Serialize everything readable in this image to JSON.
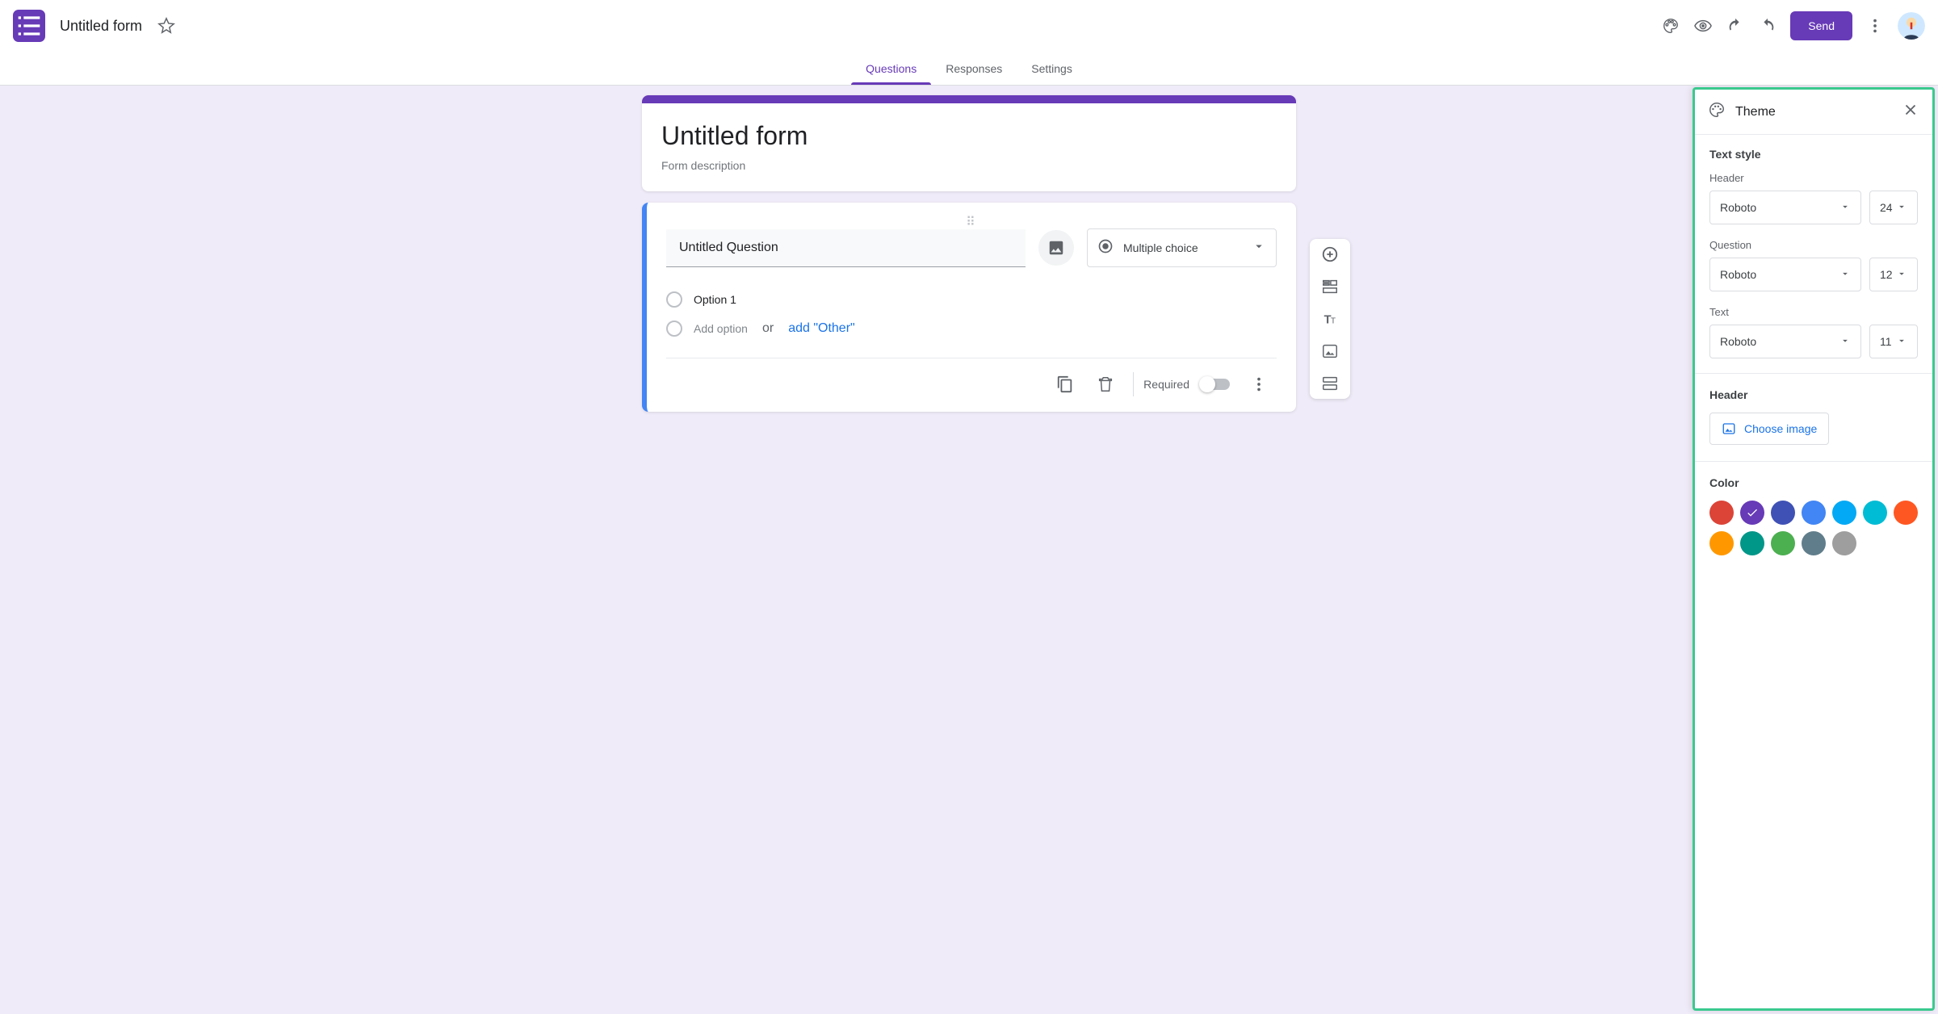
{
  "header": {
    "doc_title": "Untitled form",
    "send_label": "Send"
  },
  "tabs": {
    "questions": "Questions",
    "responses": "Responses",
    "settings": "Settings"
  },
  "form": {
    "title": "Untitled form",
    "description_placeholder": "Form description",
    "question_text": "Untitled Question",
    "question_type": "Multiple choice",
    "option1": "Option 1",
    "add_option": "Add option",
    "or": "or",
    "add_other": "add \"Other\"",
    "required_label": "Required"
  },
  "theme": {
    "panel_title": "Theme",
    "text_style": "Text style",
    "header_label": "Header",
    "question_label": "Question",
    "text_label": "Text",
    "header_font": "Roboto",
    "header_size": "24",
    "question_font": "Roboto",
    "question_size": "12",
    "text_font": "Roboto",
    "text_size": "11",
    "header_section": "Header",
    "choose_image": "Choose image",
    "color_section": "Color",
    "colors_row1": [
      "#db4437",
      "#673ab7",
      "#3f51b5",
      "#4285f4",
      "#03a9f4",
      "#00bcd4"
    ],
    "colors_row2": [
      "#ff5722",
      "#ff9800",
      "#009688",
      "#4caf50",
      "#607d8b",
      "#9e9e9e"
    ],
    "selected_color_index": 1
  }
}
